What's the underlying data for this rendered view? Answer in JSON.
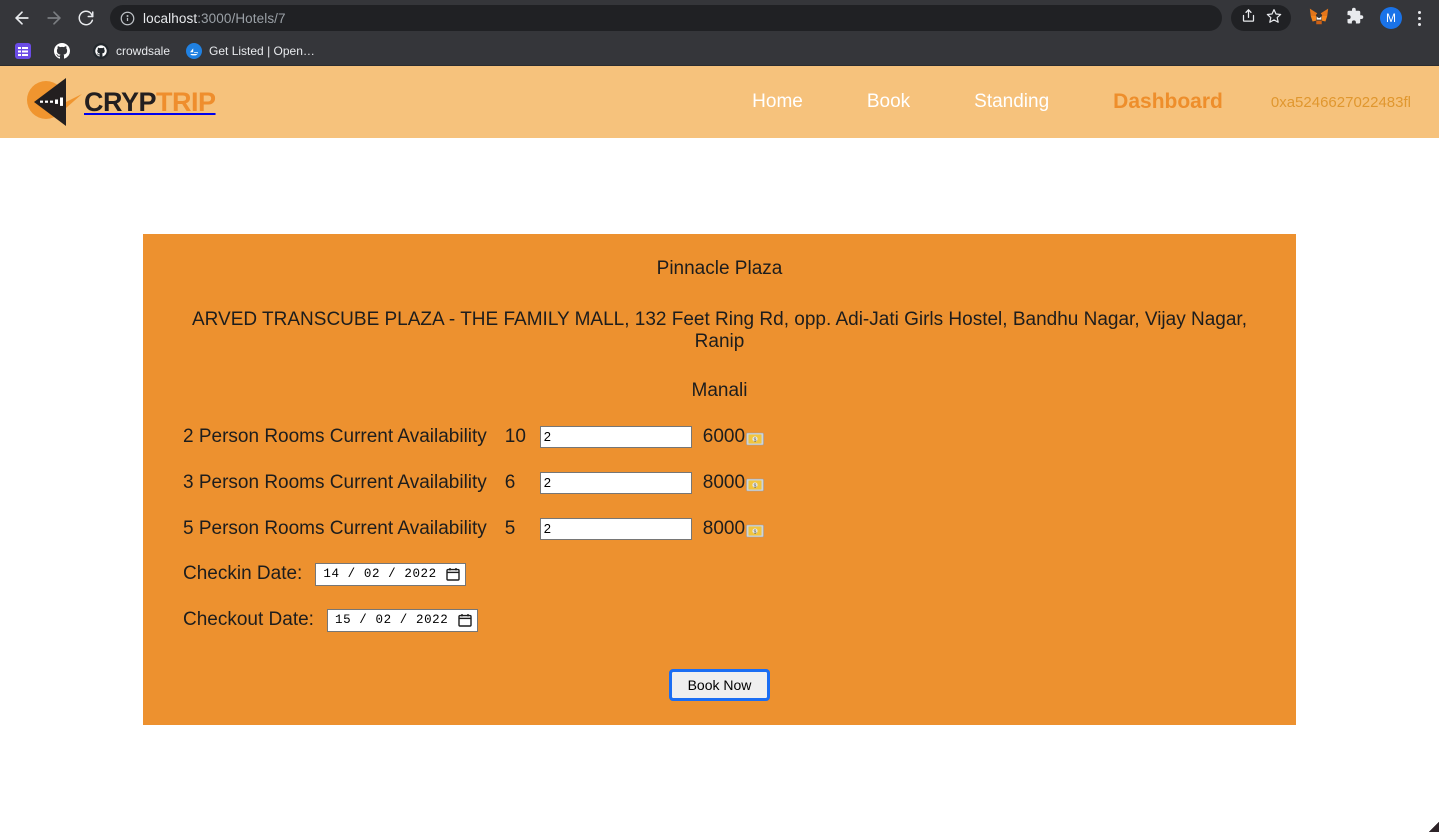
{
  "browser": {
    "back_icon": "back-arrow-icon",
    "forward_icon": "forward-arrow-icon",
    "reload_icon": "reload-icon",
    "url_host": "localhost",
    "url_path": ":3000/Hotels/7",
    "share_icon": "share-icon",
    "bookmark_icon": "star-icon",
    "metamask_icon": "metamask-fox-icon",
    "extensions_icon": "puzzle-piece-icon",
    "avatar_label": "M",
    "menu_icon": "kebab-menu-icon",
    "bookmarks": [
      {
        "label": "",
        "icon": "reading-list-icon"
      },
      {
        "label": "",
        "icon": "github-icon"
      },
      {
        "label": "crowdsale",
        "icon": "github-dark-icon"
      },
      {
        "label": "Get Listed | Open…",
        "icon": "opensea-icon"
      }
    ]
  },
  "site": {
    "logo": {
      "text_primary": "CRYP",
      "text_secondary": "TRIP",
      "icon": "paper-plane-logo-icon"
    },
    "nav_links": [
      {
        "label": "Home",
        "active": false
      },
      {
        "label": "Book",
        "active": false
      },
      {
        "label": "Standing",
        "active": false
      },
      {
        "label": "Dashboard",
        "active": true
      }
    ],
    "wallet_address": "0xa5246627022483fl"
  },
  "hotel": {
    "name": "Pinnacle Plaza",
    "address": "ARVED TRANSCUBE PLAZA - THE FAMILY MALL, 132 Feet Ring Rd, opp. Adi-Jati Girls Hostel, Bandhu Nagar, Vijay Nagar, Ranip",
    "city": "Manali",
    "rooms": [
      {
        "label": "2 Person Rooms Current Availability",
        "availability": "10",
        "quantity": "2",
        "price": "6000",
        "icon": "money-banknote-icon"
      },
      {
        "label": "3 Person Rooms Current Availability",
        "availability": "6",
        "quantity": "2",
        "price": "8000",
        "icon": "money-banknote-icon"
      },
      {
        "label": "5 Person Rooms Current Availability",
        "availability": "5",
        "quantity": "2",
        "price": "8000",
        "icon": "money-banknote-icon"
      }
    ],
    "checkin": {
      "label": "Checkin Date:",
      "value": "14 / 02 / 2022",
      "icon": "calendar-icon"
    },
    "checkout": {
      "label": "Checkout Date:",
      "value": "15 / 02 / 2022",
      "icon": "calendar-icon"
    },
    "book_button": "Book Now"
  },
  "colors": {
    "navbar": "#f6c27c",
    "card": "#ed912f",
    "accent": "#ee8e2b",
    "focus_ring": "#1b6ef3",
    "chrome": "#35363a"
  }
}
